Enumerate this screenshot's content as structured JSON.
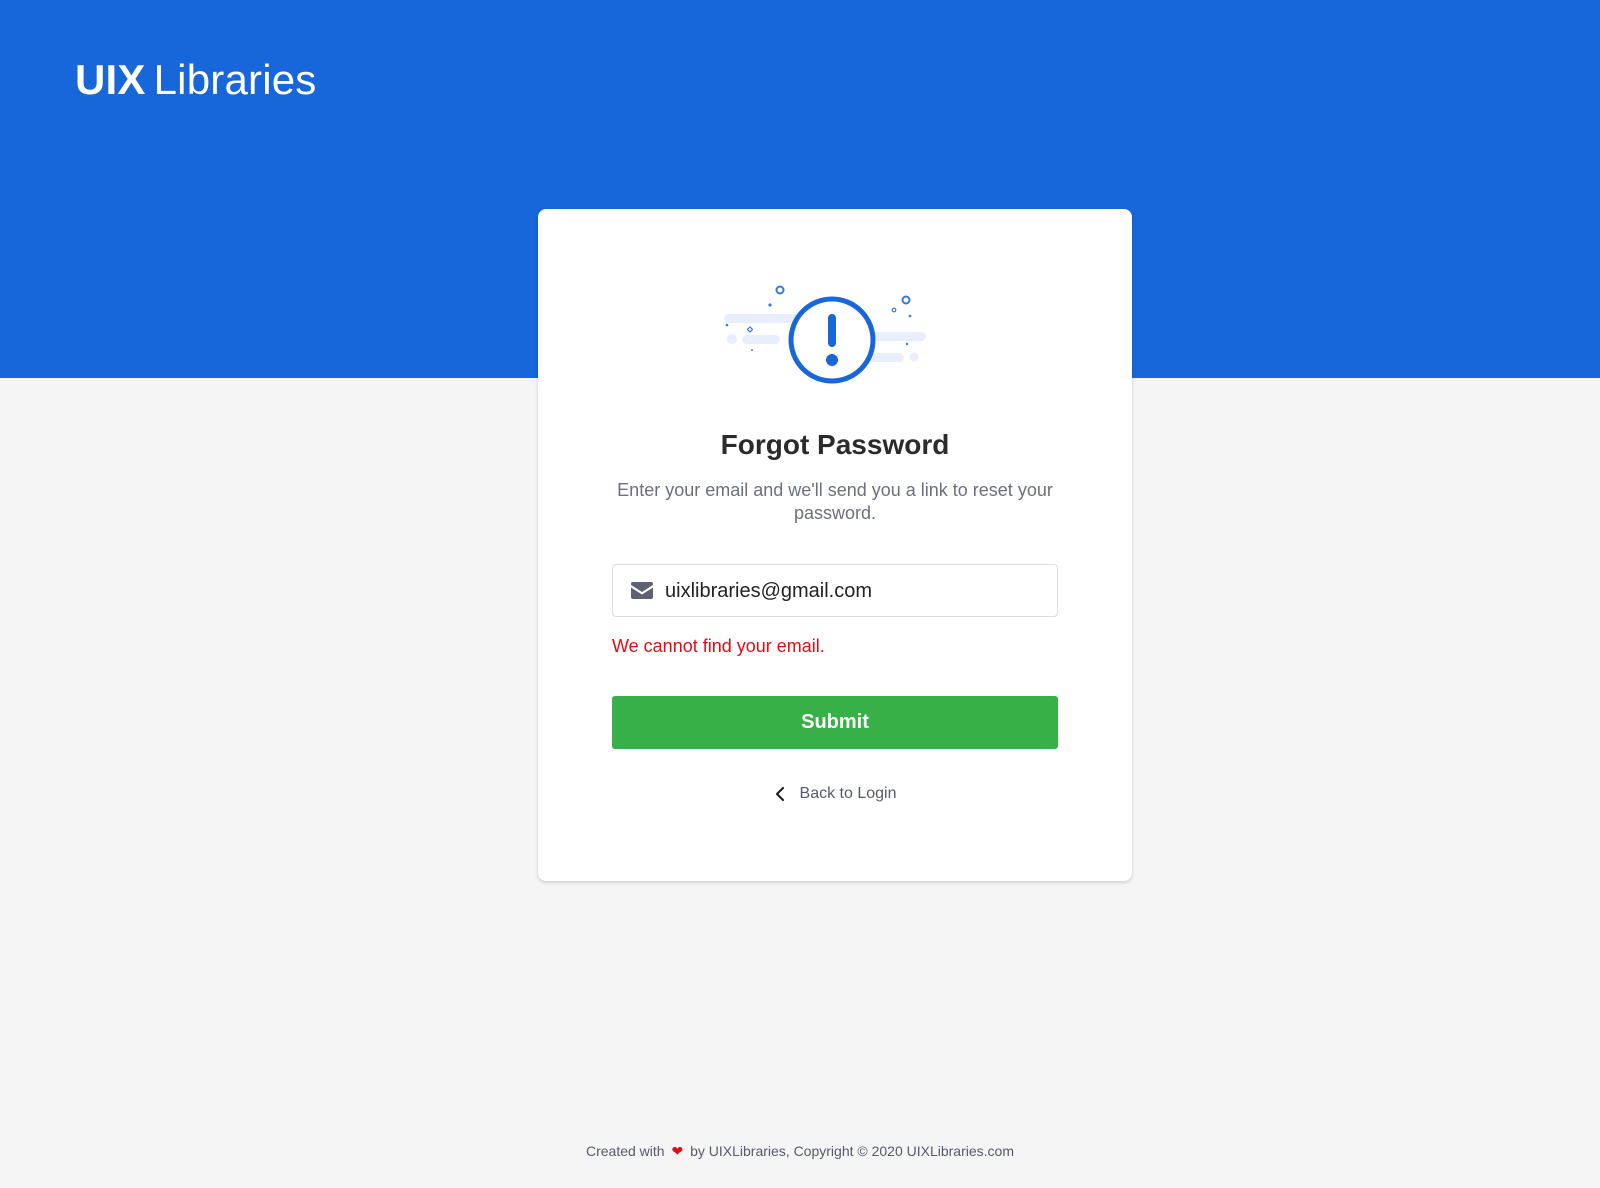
{
  "brand": {
    "logo_bold": "UIX",
    "logo_light": "Libraries",
    "primary_color": "#1767db"
  },
  "card": {
    "illustration_icon": "exclamation-circle-icon",
    "title": "Forgot Password",
    "subtitle": "Enter your email and we'll send you a link to reset your password.",
    "email": {
      "icon": "envelope-icon",
      "value": "uixlibraries@gmail.com"
    },
    "error_message": "We cannot find your email.",
    "error_color": "#e00d12",
    "submit_label": "Submit",
    "submit_color": "#38b048",
    "back_label": "Back to Login",
    "back_icon": "chevron-left-icon"
  },
  "footer": {
    "prefix": "Created with",
    "heart": "❤",
    "suffix": "by UIXLibraries, Copyright © 2020 UIXLibraries.com"
  }
}
